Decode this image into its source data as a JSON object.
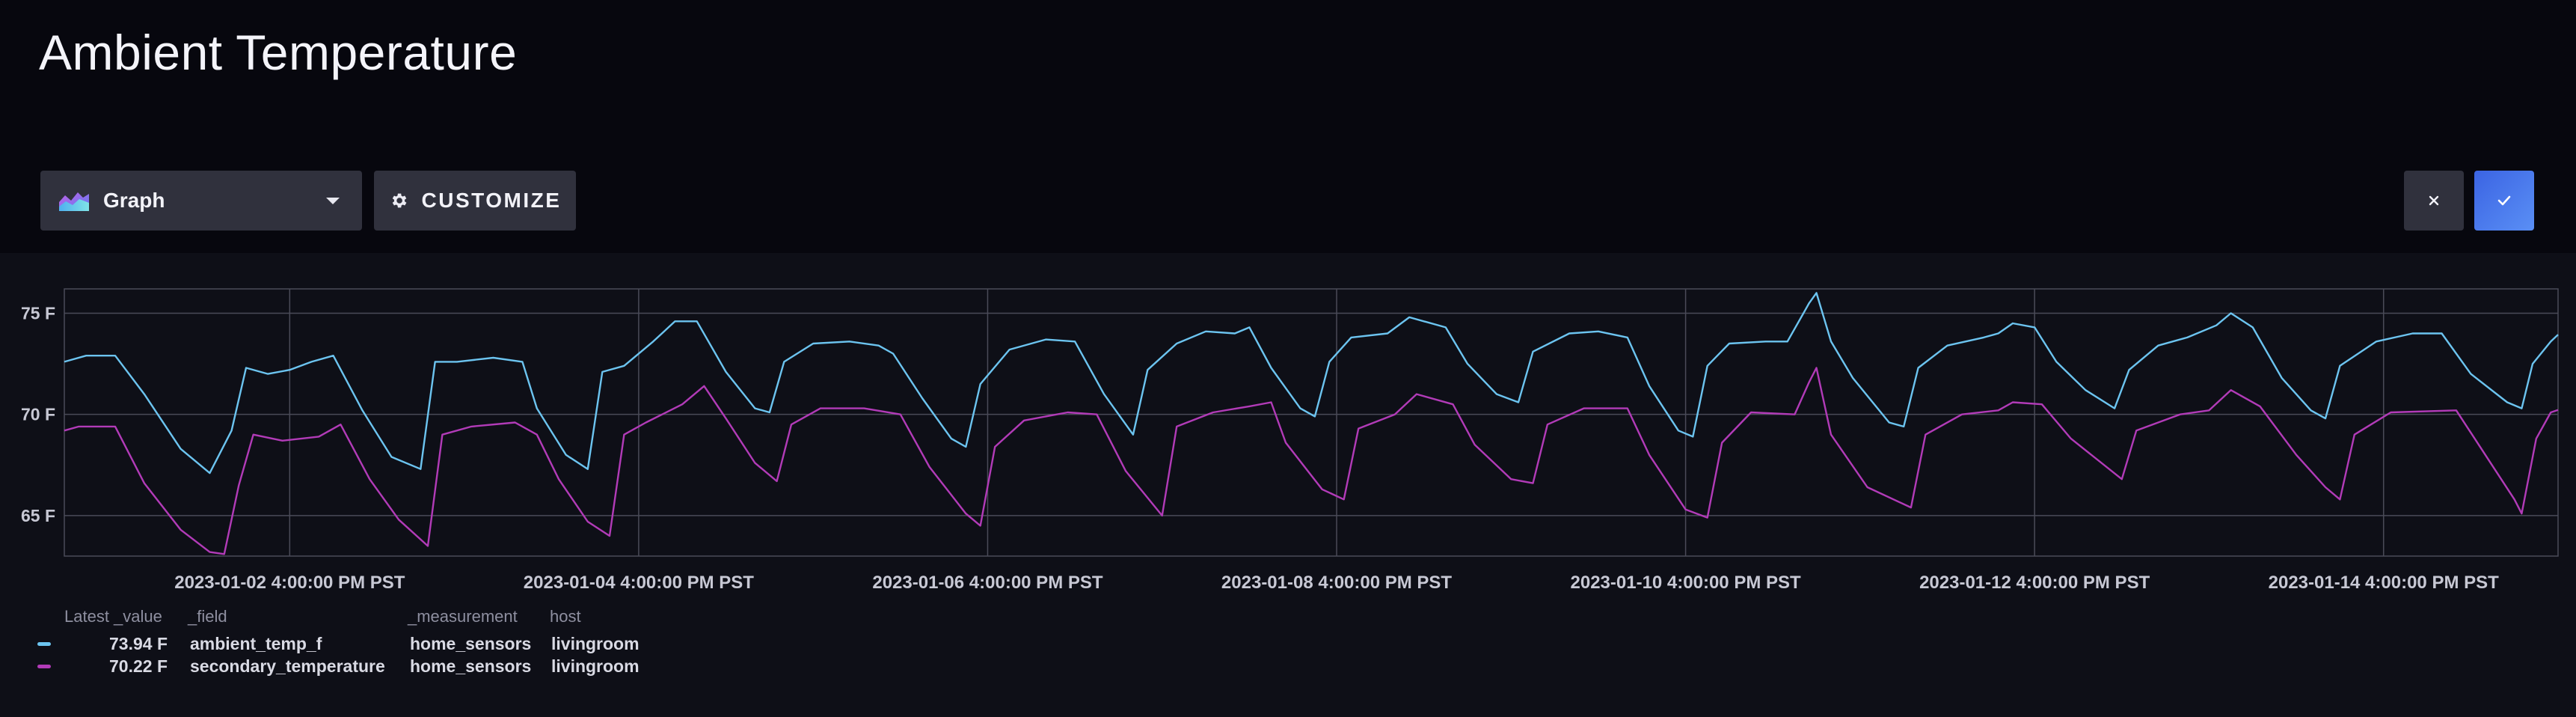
{
  "header": {
    "title": "Ambient Temperature"
  },
  "toolbar": {
    "view_type_label": "Graph",
    "customize_label": "CUSTOMIZE",
    "cancel_icon": "close-icon",
    "confirm_icon": "check-icon"
  },
  "colors": {
    "accent": "#4c7cf0",
    "series_ambient": "#6cc4f0",
    "series_secondary": "#b23bb8"
  },
  "legend": {
    "headers": [
      "Latest _value",
      "_field",
      "_measurement",
      "host"
    ],
    "rows": [
      {
        "value": "73.94 F",
        "field": "ambient_temp_f",
        "measurement": "home_sensors",
        "host": "livingroom",
        "color": "#6cc4f0"
      },
      {
        "value": "70.22 F",
        "field": "secondary_temperature",
        "measurement": "home_sensors",
        "host": "livingroom",
        "color": "#b23bb8"
      }
    ]
  },
  "chart_data": {
    "type": "line",
    "x_start": "2023-01-01 9:00:00 AM PST",
    "x_end": "2023-01-15 4:00:00 PM PST",
    "ylim": [
      63,
      76.2
    ],
    "y_ticks": [
      {
        "value": 65,
        "label": "65 F"
      },
      {
        "value": 70,
        "label": "70 F"
      },
      {
        "value": 75,
        "label": "75 F"
      }
    ],
    "x_ticks": [
      {
        "date": "2023-01-02 4:00:00 PM PST",
        "label": "2023-01-02  4:00:00 PM PST"
      },
      {
        "date": "2023-01-04 4:00:00 PM PST",
        "label": "2023-01-04  4:00:00 PM PST"
      },
      {
        "date": "2023-01-06 4:00:00 PM PST",
        "label": "2023-01-06  4:00:00 PM PST"
      },
      {
        "date": "2023-01-08 4:00:00 PM PST",
        "label": "2023-01-08  4:00:00 PM PST"
      },
      {
        "date": "2023-01-10 4:00:00 PM PST",
        "label": "2023-01-10  4:00:00 PM PST"
      },
      {
        "date": "2023-01-12 4:00:00 PM PST",
        "label": "2023-01-12  4:00:00 PM PST"
      },
      {
        "date": "2023-01-14 4:00:00 PM PST",
        "label": "2023-01-14  4:00:00 PM PST"
      }
    ],
    "grid": true,
    "legend_placement": "bottom-left",
    "series": [
      {
        "name": "ambient_temp_f",
        "color": "#6cc4f0",
        "points": [
          [
            "2023-01-01 9:00 AM",
            72.6
          ],
          [
            "2023-01-01 12:00 PM",
            72.9
          ],
          [
            "2023-01-01 4:00 PM",
            72.9
          ],
          [
            "2023-01-01 8:00 PM",
            71.0
          ],
          [
            "2023-01-02 1:00 AM",
            68.3
          ],
          [
            "2023-01-02 5:00 AM",
            67.1
          ],
          [
            "2023-01-02 8:00 AM",
            69.2
          ],
          [
            "2023-01-02 10:00 AM",
            72.3
          ],
          [
            "2023-01-02 1:00 PM",
            72.0
          ],
          [
            "2023-01-02 4:00 PM",
            72.2
          ],
          [
            "2023-01-02 7:00 PM",
            72.6
          ],
          [
            "2023-01-02 10:00 PM",
            72.9
          ],
          [
            "2023-01-03 2:00 AM",
            70.2
          ],
          [
            "2023-01-03 6:00 AM",
            67.9
          ],
          [
            "2023-01-03 10:00 AM",
            67.3
          ],
          [
            "2023-01-03 12:00 PM",
            72.6
          ],
          [
            "2023-01-03 3:00 PM",
            72.6
          ],
          [
            "2023-01-03 8:00 PM",
            72.8
          ],
          [
            "2023-01-04 12:00 AM",
            72.6
          ],
          [
            "2023-01-04 2:00 AM",
            70.3
          ],
          [
            "2023-01-04 6:00 AM",
            68.0
          ],
          [
            "2023-01-04 9:00 AM",
            67.3
          ],
          [
            "2023-01-04 11:00 AM",
            72.1
          ],
          [
            "2023-01-04 2:00 PM",
            72.4
          ],
          [
            "2023-01-04 6:00 PM",
            73.6
          ],
          [
            "2023-01-04 9:00 PM",
            74.6
          ],
          [
            "2023-01-05 12:00 AM",
            74.6
          ],
          [
            "2023-01-05 4:00 AM",
            72.1
          ],
          [
            "2023-01-05 8:00 AM",
            70.3
          ],
          [
            "2023-01-05 10:00 AM",
            70.1
          ],
          [
            "2023-01-05 12:00 PM",
            72.6
          ],
          [
            "2023-01-05 4:00 PM",
            73.5
          ],
          [
            "2023-01-05 9:00 PM",
            73.6
          ],
          [
            "2023-01-06 1:00 AM",
            73.4
          ],
          [
            "2023-01-06 3:00 AM",
            73.0
          ],
          [
            "2023-01-06 7:00 AM",
            70.8
          ],
          [
            "2023-01-06 11:00 AM",
            68.8
          ],
          [
            "2023-01-06 1:00 PM",
            68.4
          ],
          [
            "2023-01-06 3:00 PM",
            71.5
          ],
          [
            "2023-01-06 7:00 PM",
            73.2
          ],
          [
            "2023-01-07 12:00 AM",
            73.7
          ],
          [
            "2023-01-07 4:00 AM",
            73.6
          ],
          [
            "2023-01-07 8:00 AM",
            71.0
          ],
          [
            "2023-01-07 12:00 PM",
            69.0
          ],
          [
            "2023-01-07 2:00 PM",
            72.2
          ],
          [
            "2023-01-07 6:00 PM",
            73.5
          ],
          [
            "2023-01-07 10:00 PM",
            74.1
          ],
          [
            "2023-01-08 2:00 AM",
            74.0
          ],
          [
            "2023-01-08 4:00 AM",
            74.3
          ],
          [
            "2023-01-08 7:00 AM",
            72.3
          ],
          [
            "2023-01-08 11:00 AM",
            70.3
          ],
          [
            "2023-01-08 1:00 PM",
            69.9
          ],
          [
            "2023-01-08 3:00 PM",
            72.6
          ],
          [
            "2023-01-08 6:00 PM",
            73.8
          ],
          [
            "2023-01-08 11:00 PM",
            74.0
          ],
          [
            "2023-01-09 2:00 AM",
            74.8
          ],
          [
            "2023-01-09 7:00 AM",
            74.3
          ],
          [
            "2023-01-09 10:00 AM",
            72.5
          ],
          [
            "2023-01-09 2:00 PM",
            71.0
          ],
          [
            "2023-01-09 5:00 PM",
            70.6
          ],
          [
            "2023-01-09 7:00 PM",
            73.1
          ],
          [
            "2023-01-10 12:00 AM",
            74.0
          ],
          [
            "2023-01-10 4:00 AM",
            74.1
          ],
          [
            "2023-01-10 8:00 AM",
            73.8
          ],
          [
            "2023-01-10 11:00 AM",
            71.4
          ],
          [
            "2023-01-10 3:00 PM",
            69.2
          ],
          [
            "2023-01-10 5:00 PM",
            68.9
          ],
          [
            "2023-01-10 7:00 PM",
            72.4
          ],
          [
            "2023-01-10 10:00 PM",
            73.5
          ],
          [
            "2023-01-11 3:00 AM",
            73.6
          ],
          [
            "2023-01-11 6:00 AM",
            73.6
          ],
          [
            "2023-01-11 9:00 AM",
            75.5
          ],
          [
            "2023-01-11 10:00 AM",
            76.0
          ],
          [
            "2023-01-11 12:00 PM",
            73.6
          ],
          [
            "2023-01-11 3:00 PM",
            71.8
          ],
          [
            "2023-01-11 8:00 PM",
            69.6
          ],
          [
            "2023-01-11 10:00 PM",
            69.4
          ],
          [
            "2023-01-12 12:00 AM",
            72.3
          ],
          [
            "2023-01-12 4:00 AM",
            73.4
          ],
          [
            "2023-01-12 9:00 AM",
            73.8
          ],
          [
            "2023-01-12 11:00 AM",
            74.0
          ],
          [
            "2023-01-12 1:00 PM",
            74.5
          ],
          [
            "2023-01-12 4:00 PM",
            74.3
          ],
          [
            "2023-01-12 7:00 PM",
            72.6
          ],
          [
            "2023-01-12 11:00 PM",
            71.2
          ],
          [
            "2023-01-13 3:00 AM",
            70.3
          ],
          [
            "2023-01-13 5:00 AM",
            72.2
          ],
          [
            "2023-01-13 9:00 AM",
            73.4
          ],
          [
            "2023-01-13 1:00 PM",
            73.8
          ],
          [
            "2023-01-13 5:00 PM",
            74.4
          ],
          [
            "2023-01-13 7:00 PM",
            75.0
          ],
          [
            "2023-01-13 10:00 PM",
            74.3
          ],
          [
            "2023-01-14 2:00 AM",
            71.8
          ],
          [
            "2023-01-14 6:00 AM",
            70.2
          ],
          [
            "2023-01-14 8:00 AM",
            69.8
          ],
          [
            "2023-01-14 10:00 AM",
            72.4
          ],
          [
            "2023-01-14 3:00 PM",
            73.6
          ],
          [
            "2023-01-14 8:00 PM",
            74.0
          ],
          [
            "2023-01-15 12:00 AM",
            74.0
          ],
          [
            "2023-01-15 4:00 AM",
            72.0
          ],
          [
            "2023-01-15 9:00 AM",
            70.6
          ],
          [
            "2023-01-15 11:00 AM",
            70.3
          ],
          [
            "2023-01-15 12:30 PM",
            72.5
          ],
          [
            "2023-01-15 3:00 PM",
            73.6
          ],
          [
            "2023-01-15 4:00 PM",
            73.94
          ]
        ]
      },
      {
        "name": "secondary_temperature",
        "color": "#b23bb8",
        "points": [
          [
            "2023-01-01 9:00 AM",
            69.2
          ],
          [
            "2023-01-01 11:00 AM",
            69.4
          ],
          [
            "2023-01-01 4:00 PM",
            69.4
          ],
          [
            "2023-01-01 8:00 PM",
            66.6
          ],
          [
            "2023-01-02 1:00 AM",
            64.3
          ],
          [
            "2023-01-02 5:00 AM",
            63.2
          ],
          [
            "2023-01-02 7:00 AM",
            63.1
          ],
          [
            "2023-01-02 9:00 AM",
            66.5
          ],
          [
            "2023-01-02 11:00 AM",
            69.0
          ],
          [
            "2023-01-02 3:00 PM",
            68.7
          ],
          [
            "2023-01-02 8:00 PM",
            68.9
          ],
          [
            "2023-01-02 11:00 PM",
            69.5
          ],
          [
            "2023-01-03 3:00 AM",
            66.8
          ],
          [
            "2023-01-03 7:00 AM",
            64.8
          ],
          [
            "2023-01-03 11:00 AM",
            63.5
          ],
          [
            "2023-01-03 1:00 PM",
            69.0
          ],
          [
            "2023-01-03 5:00 PM",
            69.4
          ],
          [
            "2023-01-03 11:00 PM",
            69.6
          ],
          [
            "2023-01-04 2:00 AM",
            69.0
          ],
          [
            "2023-01-04 5:00 AM",
            66.8
          ],
          [
            "2023-01-04 9:00 AM",
            64.7
          ],
          [
            "2023-01-04 12:00 PM",
            64.0
          ],
          [
            "2023-01-04 2:00 PM",
            69.0
          ],
          [
            "2023-01-04 5:00 PM",
            69.6
          ],
          [
            "2023-01-04 10:00 PM",
            70.5
          ],
          [
            "2023-01-05 1:00 AM",
            71.4
          ],
          [
            "2023-01-05 4:00 AM",
            69.8
          ],
          [
            "2023-01-05 8:00 AM",
            67.6
          ],
          [
            "2023-01-05 11:00 AM",
            66.7
          ],
          [
            "2023-01-05 1:00 PM",
            69.5
          ],
          [
            "2023-01-05 5:00 PM",
            70.3
          ],
          [
            "2023-01-05 11:00 PM",
            70.3
          ],
          [
            "2023-01-06 4:00 AM",
            70.0
          ],
          [
            "2023-01-06 8:00 AM",
            67.4
          ],
          [
            "2023-01-06 1:00 PM",
            65.1
          ],
          [
            "2023-01-06 3:00 PM",
            64.5
          ],
          [
            "2023-01-06 5:00 PM",
            68.4
          ],
          [
            "2023-01-06 9:00 PM",
            69.7
          ],
          [
            "2023-01-07 3:00 AM",
            70.1
          ],
          [
            "2023-01-07 7:00 AM",
            70.0
          ],
          [
            "2023-01-07 11:00 AM",
            67.2
          ],
          [
            "2023-01-07 4:00 PM",
            65.0
          ],
          [
            "2023-01-07 6:00 PM",
            69.4
          ],
          [
            "2023-01-07 11:00 PM",
            70.1
          ],
          [
            "2023-01-08 4:00 AM",
            70.4
          ],
          [
            "2023-01-08 7:00 AM",
            70.6
          ],
          [
            "2023-01-08 9:00 AM",
            68.6
          ],
          [
            "2023-01-08 2:00 PM",
            66.3
          ],
          [
            "2023-01-08 5:00 PM",
            65.8
          ],
          [
            "2023-01-08 7:00 PM",
            69.3
          ],
          [
            "2023-01-09 12:00 AM",
            70.0
          ],
          [
            "2023-01-09 3:00 AM",
            71.0
          ],
          [
            "2023-01-09 8:00 AM",
            70.5
          ],
          [
            "2023-01-09 11:00 AM",
            68.5
          ],
          [
            "2023-01-09 4:00 PM",
            66.8
          ],
          [
            "2023-01-09 7:00 PM",
            66.6
          ],
          [
            "2023-01-09 9:00 PM",
            69.5
          ],
          [
            "2023-01-10 2:00 AM",
            70.3
          ],
          [
            "2023-01-10 8:00 AM",
            70.3
          ],
          [
            "2023-01-10 11:00 AM",
            68.0
          ],
          [
            "2023-01-10 4:00 PM",
            65.3
          ],
          [
            "2023-01-10 7:00 PM",
            64.9
          ],
          [
            "2023-01-10 9:00 PM",
            68.6
          ],
          [
            "2023-01-11 1:00 AM",
            70.1
          ],
          [
            "2023-01-11 7:00 AM",
            70.0
          ],
          [
            "2023-01-11 9:00 AM",
            71.6
          ],
          [
            "2023-01-11 10:00 AM",
            72.3
          ],
          [
            "2023-01-11 12:00 PM",
            69.0
          ],
          [
            "2023-01-11 5:00 PM",
            66.4
          ],
          [
            "2023-01-11 11:00 PM",
            65.4
          ],
          [
            "2023-01-12 1:00 AM",
            69.0
          ],
          [
            "2023-01-12 6:00 AM",
            70.0
          ],
          [
            "2023-01-12 11:00 AM",
            70.2
          ],
          [
            "2023-01-12 1:00 PM",
            70.6
          ],
          [
            "2023-01-12 5:00 PM",
            70.5
          ],
          [
            "2023-01-12 9:00 PM",
            68.8
          ],
          [
            "2023-01-13 4:00 AM",
            66.8
          ],
          [
            "2023-01-13 6:00 AM",
            69.2
          ],
          [
            "2023-01-13 12:00 PM",
            70.0
          ],
          [
            "2023-01-13 4:00 PM",
            70.2
          ],
          [
            "2023-01-13 7:00 PM",
            71.2
          ],
          [
            "2023-01-13 11:00 PM",
            70.4
          ],
          [
            "2023-01-14 4:00 AM",
            68.0
          ],
          [
            "2023-01-14 8:00 AM",
            66.4
          ],
          [
            "2023-01-14 10:00 AM",
            65.8
          ],
          [
            "2023-01-14 12:00 PM",
            69.0
          ],
          [
            "2023-01-14 5:00 PM",
            70.1
          ],
          [
            "2023-01-15 2:00 AM",
            70.2
          ],
          [
            "2023-01-15 6:00 AM",
            68.0
          ],
          [
            "2023-01-15 10:00 AM",
            65.8
          ],
          [
            "2023-01-15 11:00 AM",
            65.1
          ],
          [
            "2023-01-15 1:00 PM",
            68.8
          ],
          [
            "2023-01-15 3:00 PM",
            70.1
          ],
          [
            "2023-01-15 4:00 PM",
            70.22
          ]
        ]
      }
    ]
  }
}
